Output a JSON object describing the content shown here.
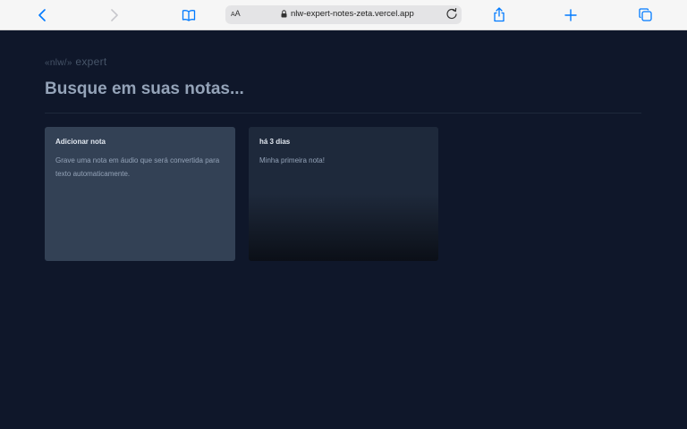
{
  "browser": {
    "aa_label_small": "A",
    "aa_label_large": "A",
    "url": "nlw-expert-notes-zeta.vercel.app",
    "icons": [
      "chevron-left-icon",
      "chevron-right-icon",
      "book-icon",
      "lock-icon",
      "reload-icon",
      "share-icon",
      "plus-icon",
      "tabs-icon"
    ],
    "accent_color": "#007aff"
  },
  "app": {
    "logo_brackets_left": "«nlw/»",
    "logo_word": "expert",
    "search_placeholder": "Busque em suas notas...",
    "background_color": "#0f172a"
  },
  "cards": {
    "add": {
      "title": "Adicionar nota",
      "body": "Grave uma nota em áudio que será convertida para texto automaticamente."
    },
    "note": {
      "date": "há 3 dias",
      "content": "Minha primeira nota!"
    }
  }
}
